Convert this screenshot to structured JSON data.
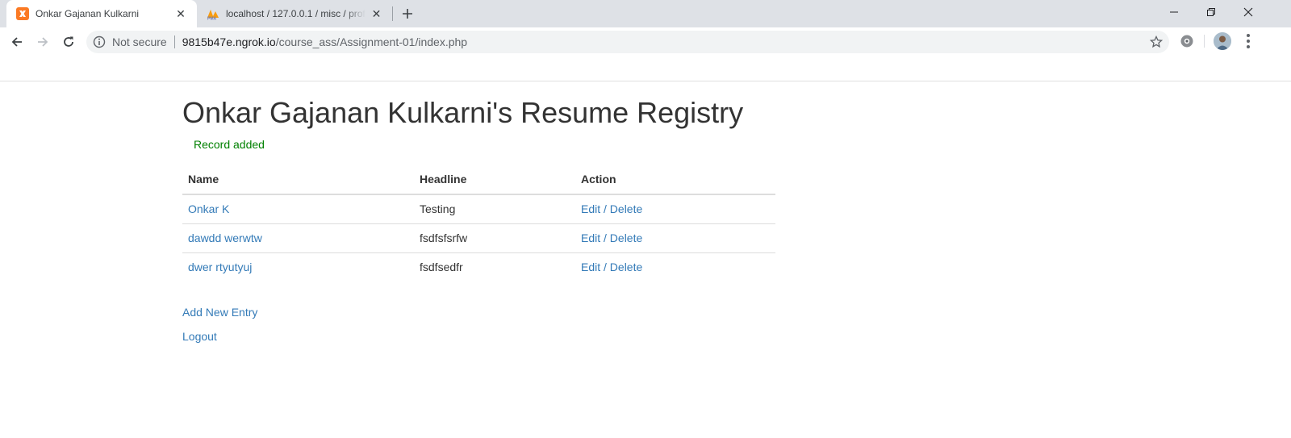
{
  "browser": {
    "tabs": [
      {
        "title": "Onkar Gajanan Kulkarni",
        "active": true,
        "favicon": "xampp-icon"
      },
      {
        "title": "localhost / 127.0.0.1 / misc / profile",
        "active": false,
        "favicon": "phpmyadmin-icon"
      }
    ],
    "security_label": "Not secure",
    "url_host": "9815b47e.ngrok.io",
    "url_path": "/course_ass/Assignment-01/index.php",
    "colors": {
      "tabstrip": "#dee1e6",
      "omnibox": "#f1f3f4"
    }
  },
  "page": {
    "title": "Onkar Gajanan Kulkarni's Resume Registry",
    "flash_message": "Record added",
    "table": {
      "headers": {
        "name": "Name",
        "headline": "Headline",
        "action": "Action"
      },
      "rows": [
        {
          "name": "Onkar K",
          "headline": "Testing",
          "edit": "Edit",
          "separator": "/",
          "delete": "Delete"
        },
        {
          "name": "dawdd werwtw",
          "headline": "fsdfsfsrfw",
          "edit": "Edit",
          "separator": "/",
          "delete": "Delete"
        },
        {
          "name": "dwer rtyutyuj",
          "headline": "fsdfsedfr",
          "edit": "Edit",
          "separator": "/",
          "delete": "Delete"
        }
      ]
    },
    "links": {
      "add_new": "Add New Entry",
      "logout": "Logout"
    },
    "colors": {
      "link": "#337ab7",
      "flash": "#008000",
      "text": "#333333"
    }
  }
}
